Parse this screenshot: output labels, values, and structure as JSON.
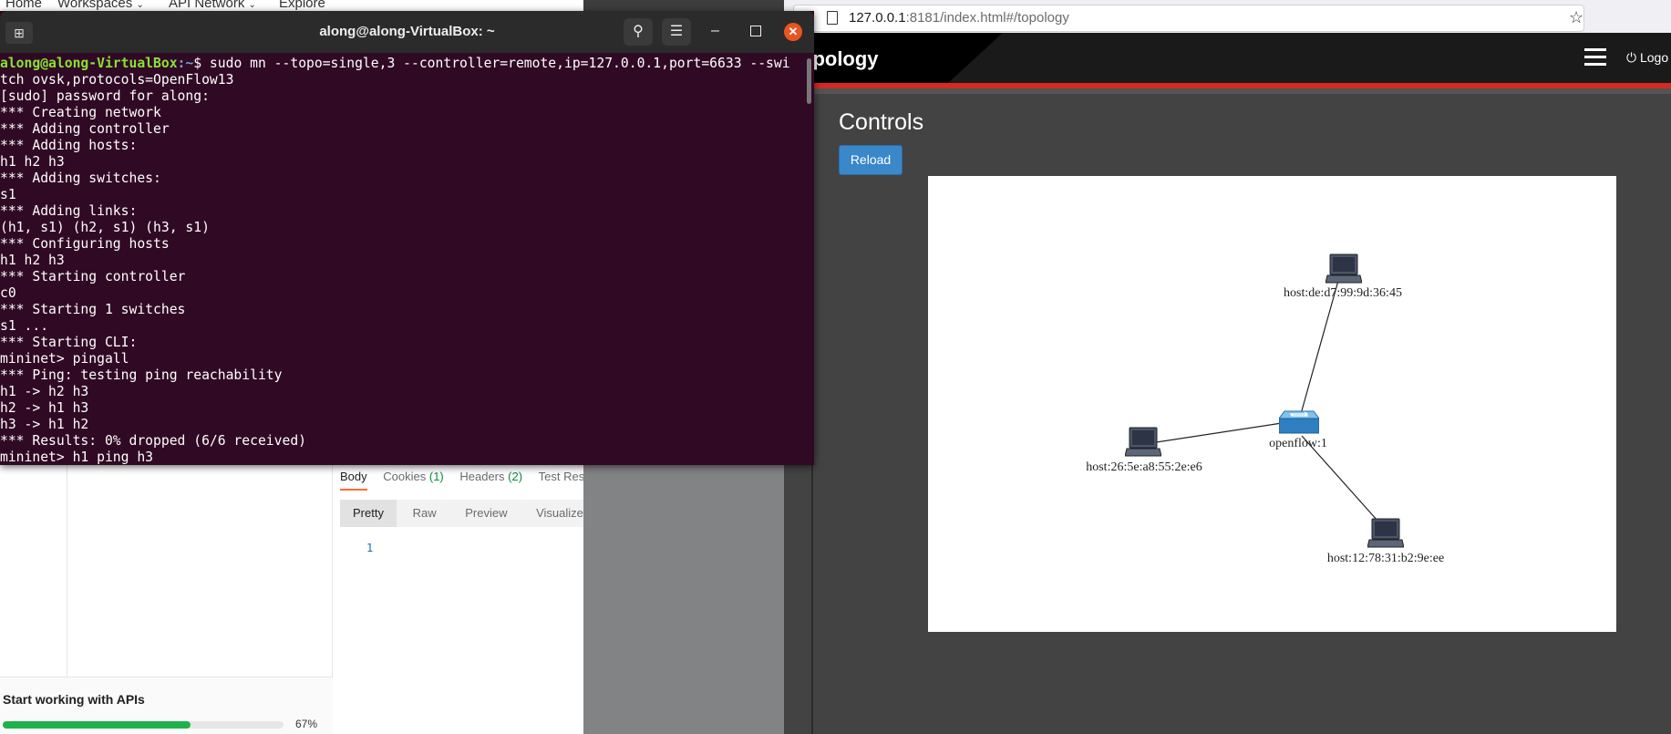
{
  "postman": {
    "top_nav": [
      {
        "label": "Home",
        "has_chevron": false
      },
      {
        "label": "Workspaces",
        "has_chevron": true
      },
      {
        "label": "API Network",
        "has_chevron": true
      },
      {
        "label": "Explore",
        "has_chevron": false
      }
    ],
    "response_tabs": [
      {
        "label": "Body",
        "count": "",
        "active": true
      },
      {
        "label": "Cookies",
        "count": "(1)",
        "active": false
      },
      {
        "label": "Headers",
        "count": "(2)",
        "active": false
      },
      {
        "label": "Test Resul",
        "count": "",
        "active": false
      }
    ],
    "view_modes": [
      "Pretty",
      "Raw",
      "Preview",
      "Visualize"
    ],
    "active_view": "Pretty",
    "line_number": "1",
    "onboarding": {
      "title": "Start working with APIs",
      "progress": 67,
      "progress_label": "67%"
    },
    "accent_color": "#ff6c37",
    "progress_color": "#1fb24a"
  },
  "terminal": {
    "title": "along@along-VirtualBox: ~",
    "background": "#300a24",
    "prompt_user": "along@along-VirtualBox",
    "prompt_path": ":~",
    "command_line_1": "$ sudo mn --topo=single,3 --controller=remote,ip=127.0.0.1,port=6633 --swi",
    "lines": [
      "tch ovsk,protocols=OpenFlow13",
      "[sudo] password for along:",
      "*** Creating network",
      "*** Adding controller",
      "*** Adding hosts:",
      "h1 h2 h3",
      "*** Adding switches:",
      "s1",
      "*** Adding links:",
      "(h1, s1) (h2, s1) (h3, s1)",
      "*** Configuring hosts",
      "h1 h2 h3",
      "*** Starting controller",
      "c0",
      "*** Starting 1 switches",
      "s1 ...",
      "*** Starting CLI:",
      "mininet> pingall",
      "*** Ping: testing ping reachability",
      "h1 -> h2 h3",
      "h2 -> h1 h3",
      "h3 -> h1 h2",
      "*** Results: 0% dropped (6/6 received)",
      "mininet> h1 ping h3"
    ]
  },
  "browser": {
    "url_host": "127.0.0.1",
    "url_rest": ":8181/index.html#/topology",
    "page_title_partial": "opology",
    "logout_label": "Logo",
    "controls_title": "Controls",
    "reload_label": "Reload",
    "brand_red": "#d32a22",
    "reload_color": "#3a87c9",
    "topology": {
      "switch": {
        "label": "openflow:1"
      },
      "hosts": [
        {
          "label": "host:de:d7:99:9d:36:45"
        },
        {
          "label": "host:26:5e:a8:55:2e:e6"
        },
        {
          "label": "host:12:78:31:b2:9e:ee"
        }
      ]
    }
  }
}
